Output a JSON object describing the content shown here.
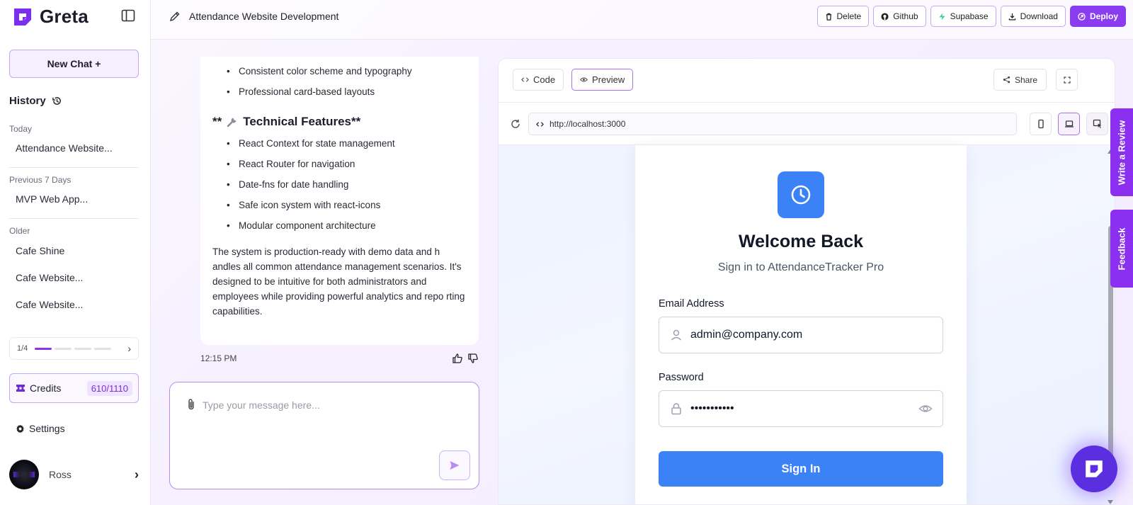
{
  "brand": {
    "name": "Greta",
    "accent": "#8b35e8"
  },
  "sidebar": {
    "new_chat_label": "New Chat +",
    "history_label": "History",
    "groups": [
      {
        "label": "Today",
        "items": [
          "Attendance Website..."
        ]
      },
      {
        "label": "Previous 7 Days",
        "items": [
          "MVP Web App..."
        ]
      },
      {
        "label": "Older",
        "items": [
          "Cafe Shine",
          "Cafe Website...",
          "Cafe Website..."
        ]
      }
    ],
    "pager": {
      "text": "1/4",
      "current": 1,
      "total": 4
    },
    "credits": {
      "label": "Credits",
      "value": "610/1110"
    },
    "settings_label": "Settings",
    "user_name": "Ross"
  },
  "topbar": {
    "project_title": "Attendance Website Development",
    "actions": [
      "Delete",
      "Github",
      "Supabase",
      "Download",
      "Deploy"
    ]
  },
  "chat": {
    "bullets_top": [
      "Consistent color scheme and typography",
      "Professional card-based layouts"
    ],
    "section_title_prefix": "**",
    "section_title": "Technical Features**",
    "bullets_tech": [
      "React Context for state management",
      "React Router for navigation",
      "Date-fns for date handling",
      "Safe icon system with react-icons",
      "Modular component architecture"
    ],
    "paragraph": "The system is production-ready with demo data and h andles all common attendance management scenarios. It's designed to be intuitive for both administrators and employees while providing powerful analytics and repo rting capabilities.",
    "time": "12:15 PM",
    "composer_placeholder": "Type your message here..."
  },
  "preview": {
    "tabs": [
      "Code",
      "Preview"
    ],
    "active_tab": "Preview",
    "share_label": "Share",
    "url": "http://localhost:3000",
    "login": {
      "title": "Welcome Back",
      "subtitle": "Sign in to AttendanceTracker Pro",
      "email_label": "Email Address",
      "email_value": "admin@company.com",
      "password_label": "Password",
      "password_value": "•••••••••••",
      "button": "Sign In",
      "primary_color": "#3b82f6"
    }
  },
  "side_tabs": {
    "review": "Write a Review",
    "feedback": "Feedback"
  }
}
